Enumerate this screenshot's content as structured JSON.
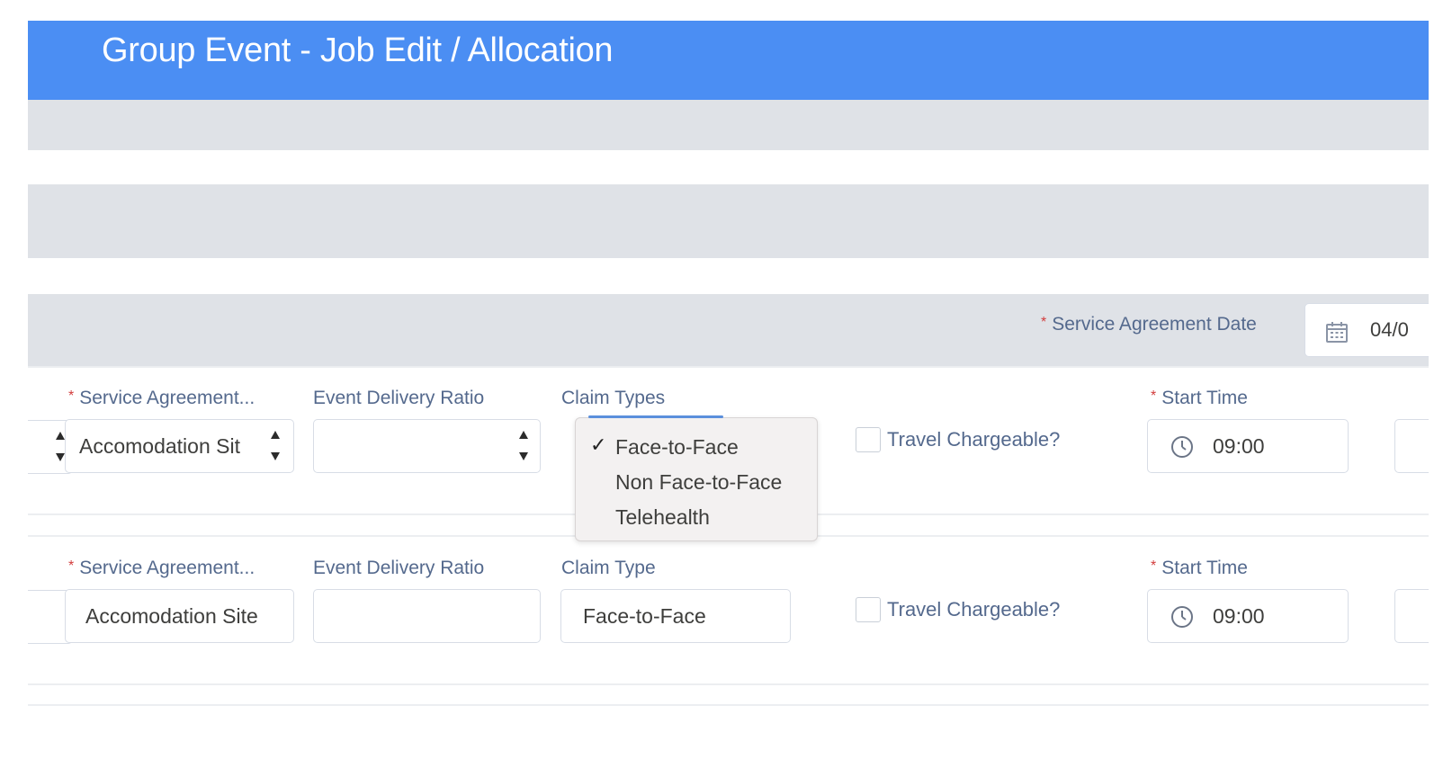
{
  "header": {
    "title": "Group Event - Job Edit / Allocation"
  },
  "agreement_date": {
    "label": "Service Agreement Date",
    "value": "04/0",
    "icon": "calendar-icon"
  },
  "rows": [
    {
      "service_agreement": {
        "label": "Service Agreement...",
        "value": "Accomodation Sit"
      },
      "delivery_ratio": {
        "label": "Event Delivery Ratio",
        "value": ""
      },
      "claim": {
        "label": "Claim Types",
        "value": ""
      },
      "travel": {
        "label": "Travel Chargeable?"
      },
      "start_time": {
        "label": "Start Time",
        "value": "09:00"
      }
    },
    {
      "service_agreement": {
        "label": "Service Agreement...",
        "value": "Accomodation Site"
      },
      "delivery_ratio": {
        "label": "Event Delivery Ratio",
        "value": ""
      },
      "claim": {
        "label": "Claim Type",
        "value": "Face-to-Face"
      },
      "travel": {
        "label": "Travel Chargeable?"
      },
      "start_time": {
        "label": "Start Time",
        "value": "09:00"
      }
    }
  ],
  "claim_dropdown": {
    "options": [
      {
        "label": "Face-to-Face",
        "selected": true,
        "check": "✓"
      },
      {
        "label": "Non Face-to-Face",
        "selected": false
      },
      {
        "label": "Telehealth",
        "selected": false
      }
    ]
  },
  "colors": {
    "header": "#4b8ef3",
    "band": "#dfe2e7",
    "required": "#d23c3c",
    "label": "#54698d"
  }
}
